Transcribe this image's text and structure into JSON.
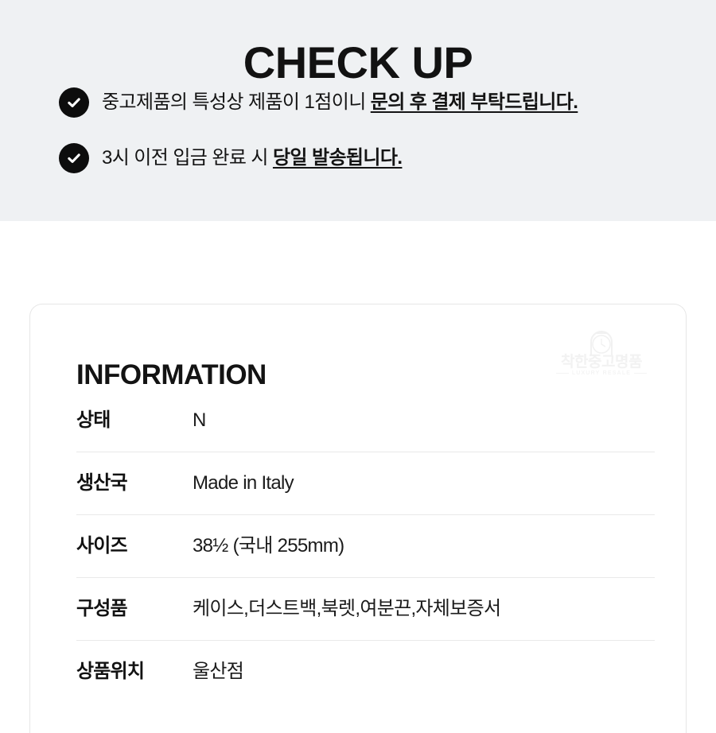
{
  "checkup": {
    "title": "CHECK UP",
    "icon": "check-circle-icon",
    "items": [
      {
        "lead": "중고제품의 특성상 제품이 1점이니 ",
        "emphasis": "문의 후 결제 부탁드립니다."
      },
      {
        "lead": "3시 이전 입금 완료 시 ",
        "emphasis": "당일 발송됩니다."
      }
    ]
  },
  "information": {
    "heading": "INFORMATION",
    "watermark": {
      "icon": "watch-icon",
      "name": "착한중고명품",
      "subtitle": "LUXURY RESALE"
    },
    "rows": [
      {
        "label": "상태",
        "value": "N"
      },
      {
        "label": "생산국",
        "value": "Made in Italy"
      },
      {
        "label": "사이즈",
        "value": "38½ (국내 255mm)"
      },
      {
        "label": "구성품",
        "value": "케이스,더스트백,북렛,여분끈,자체보증서"
      },
      {
        "label": "상품위치",
        "value": "울산점"
      }
    ]
  },
  "colors": {
    "band_background": "#eff1f3",
    "page_background": "#ffffff",
    "text_primary": "#121212",
    "icon_fill": "#0d0d0d",
    "divider": "#e9e9e9",
    "card_border": "#e6e6e6",
    "watermark": "#f2f2f2"
  }
}
